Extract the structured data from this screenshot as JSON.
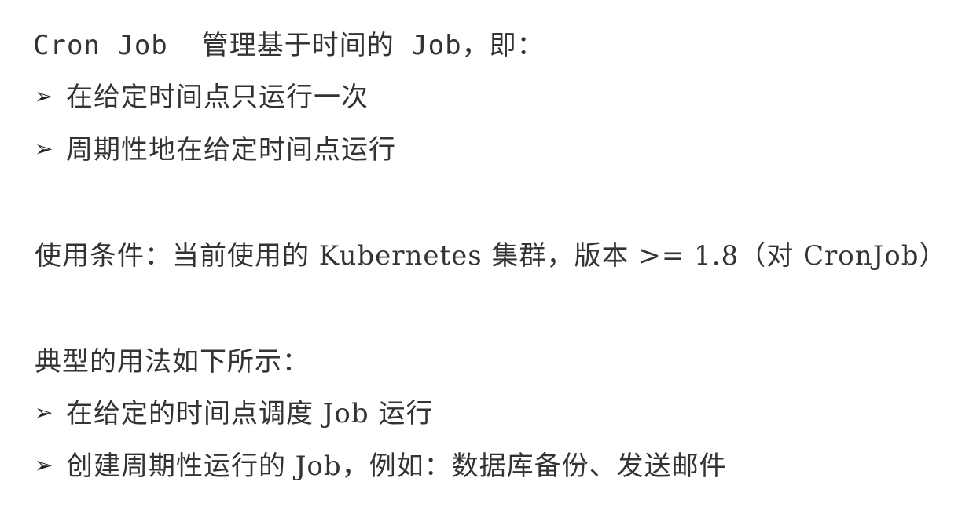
{
  "intro": "Cron Job  管理基于时间的 Job，即：",
  "intro_bullets": [
    "在给定时间点只运行一次",
    "周期性地在给定时间点运行"
  ],
  "condition": "使用条件：当前使用的 Kubernetes 集群，版本 >= 1.8（对 CronJob）",
  "usage_heading": "典型的用法如下所示：",
  "usage_bullets": [
    "在给定的时间点调度 Job 运行",
    "创建周期性运行的 Job，例如：数据库备份、发送邮件"
  ],
  "bullet_symbol": "➢"
}
